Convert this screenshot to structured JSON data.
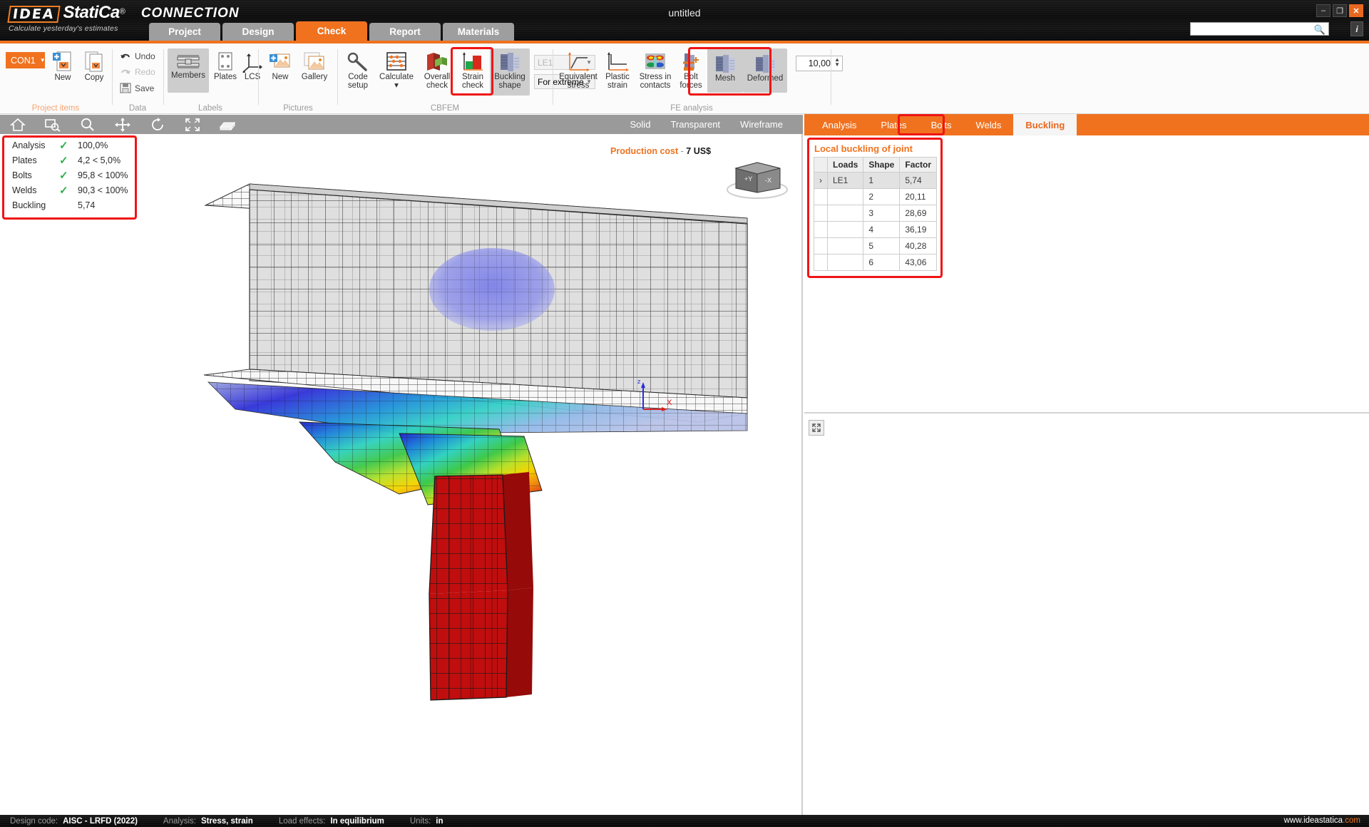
{
  "titlebar": {
    "logo_idea": "IDEA",
    "logo_statica": "StatiCa",
    "logo_reg": "®",
    "logo_product": "CONNECTION",
    "tagline": "Calculate yesterday's estimates",
    "document_title": "untitled",
    "minimize": "–",
    "maximize": "❐",
    "close": "✕",
    "search_placeholder": "",
    "search_value": "",
    "info_label": "i"
  },
  "main_tabs": [
    {
      "label": "Project",
      "active": false
    },
    {
      "label": "Design",
      "active": false
    },
    {
      "label": "Check",
      "active": true
    },
    {
      "label": "Report",
      "active": false
    },
    {
      "label": "Materials",
      "active": false
    }
  ],
  "ribbon": {
    "groups": [
      {
        "label": "Project items",
        "accent": true
      },
      {
        "label": "Data",
        "accent": false
      },
      {
        "label": "Labels",
        "accent": false
      },
      {
        "label": "Pictures",
        "accent": false
      },
      {
        "label": "CBFEM",
        "accent": false
      },
      {
        "label": "FE analysis",
        "accent": false
      }
    ],
    "connection_selector": "CON1",
    "project_items": [
      {
        "label": "New"
      },
      {
        "label": "Copy"
      }
    ],
    "data_commands": [
      {
        "label": "Undo",
        "enabled": true
      },
      {
        "label": "Redo",
        "enabled": false
      },
      {
        "label": "Save",
        "enabled": true
      }
    ],
    "labels_buttons": [
      {
        "label": "Members",
        "selected": true
      },
      {
        "label": "Plates",
        "selected": false
      },
      {
        "label": "LCS",
        "selected": false
      }
    ],
    "pictures_buttons": [
      {
        "label": "New"
      },
      {
        "label": "Gallery"
      }
    ],
    "cbfem_buttons": [
      {
        "label_line1": "Code",
        "label_line2": "setup",
        "selected": false
      },
      {
        "label_line1": "Calculate",
        "label_line2": "▾",
        "selected": false
      },
      {
        "label_line1": "Overall",
        "label_line2": "check",
        "selected": false
      },
      {
        "label_line1": "Strain",
        "label_line2": "check",
        "selected": false
      },
      {
        "label_line1": "Buckling",
        "label_line2": "shape",
        "selected": true,
        "highlighted": true
      }
    ],
    "load_case_select": "LE1",
    "extreme_select": "For extreme",
    "fe_buttons": [
      {
        "label_line1": "Equivalent",
        "label_line2": "stress",
        "selected": false
      },
      {
        "label_line1": "Plastic",
        "label_line2": "strain",
        "selected": false
      },
      {
        "label_line1": "Stress in",
        "label_line2": "contacts",
        "selected": false
      },
      {
        "label_line1": "Bolt",
        "label_line2": "forces",
        "selected": false
      },
      {
        "label_line1": "Mesh",
        "label_line2": "",
        "selected": true,
        "highlighted": true
      },
      {
        "label_line1": "Deformed",
        "label_line2": "",
        "selected": true,
        "highlighted": true
      }
    ],
    "scale_value": "10,00"
  },
  "viewport": {
    "toolbar_icons": [
      "home-icon",
      "zoom-window-icon",
      "magnifier-icon",
      "pan-icon",
      "rotate-icon",
      "fit-screen-icon",
      "box-view-icon"
    ],
    "display_modes": [
      {
        "label": "Solid",
        "active": false
      },
      {
        "label": "Transparent",
        "active": false
      },
      {
        "label": "Wireframe",
        "active": false
      }
    ],
    "production_cost_label": "Production cost",
    "production_cost_dash": "-",
    "production_cost_value": "7 US$",
    "view_cube_faces": [
      "+Y",
      "-X"
    ],
    "axis_labels": {
      "x": "X",
      "z": "z"
    }
  },
  "results_summary": {
    "highlighted": true,
    "rows": [
      {
        "name": "Analysis",
        "check": true,
        "value": "100,0%"
      },
      {
        "name": "Plates",
        "check": true,
        "value": "4,2 < 5,0%"
      },
      {
        "name": "Bolts",
        "check": true,
        "value": "95,8 < 100%"
      },
      {
        "name": "Welds",
        "check": true,
        "value": "90,3 < 100%"
      },
      {
        "name": "Buckling",
        "check": false,
        "value": "5,74"
      }
    ]
  },
  "right_panel": {
    "tabs": [
      {
        "label": "Analysis",
        "active": false
      },
      {
        "label": "Plates",
        "active": false
      },
      {
        "label": "Bolts",
        "active": false
      },
      {
        "label": "Welds",
        "active": false
      },
      {
        "label": "Buckling",
        "active": true,
        "highlighted": true
      }
    ],
    "buckling": {
      "title": "Local buckling of joint",
      "headers": [
        "",
        "Loads",
        "Shape",
        "Factor"
      ],
      "rows": [
        {
          "expand": "›",
          "loads": "LE1",
          "shape": "1",
          "factor": "5,74",
          "selected": true
        },
        {
          "expand": "",
          "loads": "",
          "shape": "2",
          "factor": "20,11",
          "selected": false
        },
        {
          "expand": "",
          "loads": "",
          "shape": "3",
          "factor": "28,69",
          "selected": false
        },
        {
          "expand": "",
          "loads": "",
          "shape": "4",
          "factor": "36,19",
          "selected": false
        },
        {
          "expand": "",
          "loads": "",
          "shape": "5",
          "factor": "40,28",
          "selected": false
        },
        {
          "expand": "",
          "loads": "",
          "shape": "6",
          "factor": "43,06",
          "selected": false
        }
      ]
    },
    "expand_button": "expand-icon"
  },
  "statusbar": {
    "design_code_key": "Design code:",
    "design_code_value": "AISC - LRFD (2022)",
    "analysis_key": "Analysis:",
    "analysis_value": "Stress, strain",
    "load_effects_key": "Load effects:",
    "load_effects_value": "In equilibrium",
    "units_key": "Units:",
    "units_value": "in",
    "website_a": "www.ideastatica",
    "website_b": ".com"
  },
  "colors": {
    "accent": "#f0721f",
    "highlight_red": "#f01414",
    "check_green": "#2bb24c",
    "toolbar_gray": "#9a9a9a"
  }
}
